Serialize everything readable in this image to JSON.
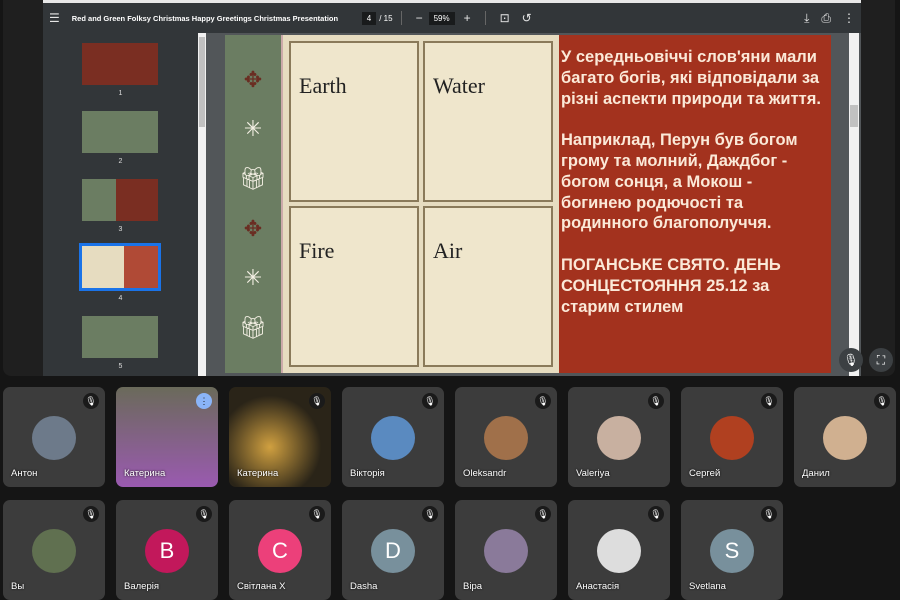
{
  "viewer": {
    "title": "Red and Green Folksy Christmas Happy Greetings Christmas Presentation",
    "page": "4",
    "total": "/ 15",
    "zoom": "59%"
  },
  "thumbnails": [
    "1",
    "2",
    "3",
    "4",
    "5"
  ],
  "slide": {
    "panels": [
      "Earth",
      "Water",
      "Fire",
      "Air"
    ],
    "paragraphs": [
      "У середньовіччі слов'яни мали багато богів, які відповідали за різні аспекти природи та життя.",
      "Наприклад, Перун був богом грому та молний, Даждбог - богом сонця, а Мокош - богинею родючості та родинного благополуччя.",
      "ПОГАНСЬКЕ СВЯТО. ДЕНЬ СОНЦЕСТОЯННЯ 25.12 за старим стилем"
    ]
  },
  "participants": [
    {
      "name": "Антон",
      "color": "#6d7a8a"
    },
    {
      "name": "Катерина",
      "color": "#8a5a9a"
    },
    {
      "name": "Катерина",
      "color": "#5a4a2a"
    },
    {
      "name": "Вікторія",
      "color": "#5a8ac0"
    },
    {
      "name": "Oleksandr",
      "color": "#a0704a"
    },
    {
      "name": "Valeriya",
      "color": "#c8b0a0"
    },
    {
      "name": "Сергей",
      "color": "#b04020"
    },
    {
      "name": "Данил",
      "color": "#d0b090"
    },
    {
      "name": "Вы",
      "color": "#607050"
    },
    {
      "name": "Валерія",
      "initial": "В",
      "color": "#c2185b"
    },
    {
      "name": "Світлана Х",
      "initial": "С",
      "color": "#ec407a"
    },
    {
      "name": "Dasha",
      "initial": "D",
      "color": "#78909c"
    },
    {
      "name": "Віра",
      "color": "#8a7a9a"
    },
    {
      "name": "Анастасія",
      "color": "#ddd"
    },
    {
      "name": "Svetlana",
      "initial": "S",
      "color": "#78909c"
    }
  ]
}
